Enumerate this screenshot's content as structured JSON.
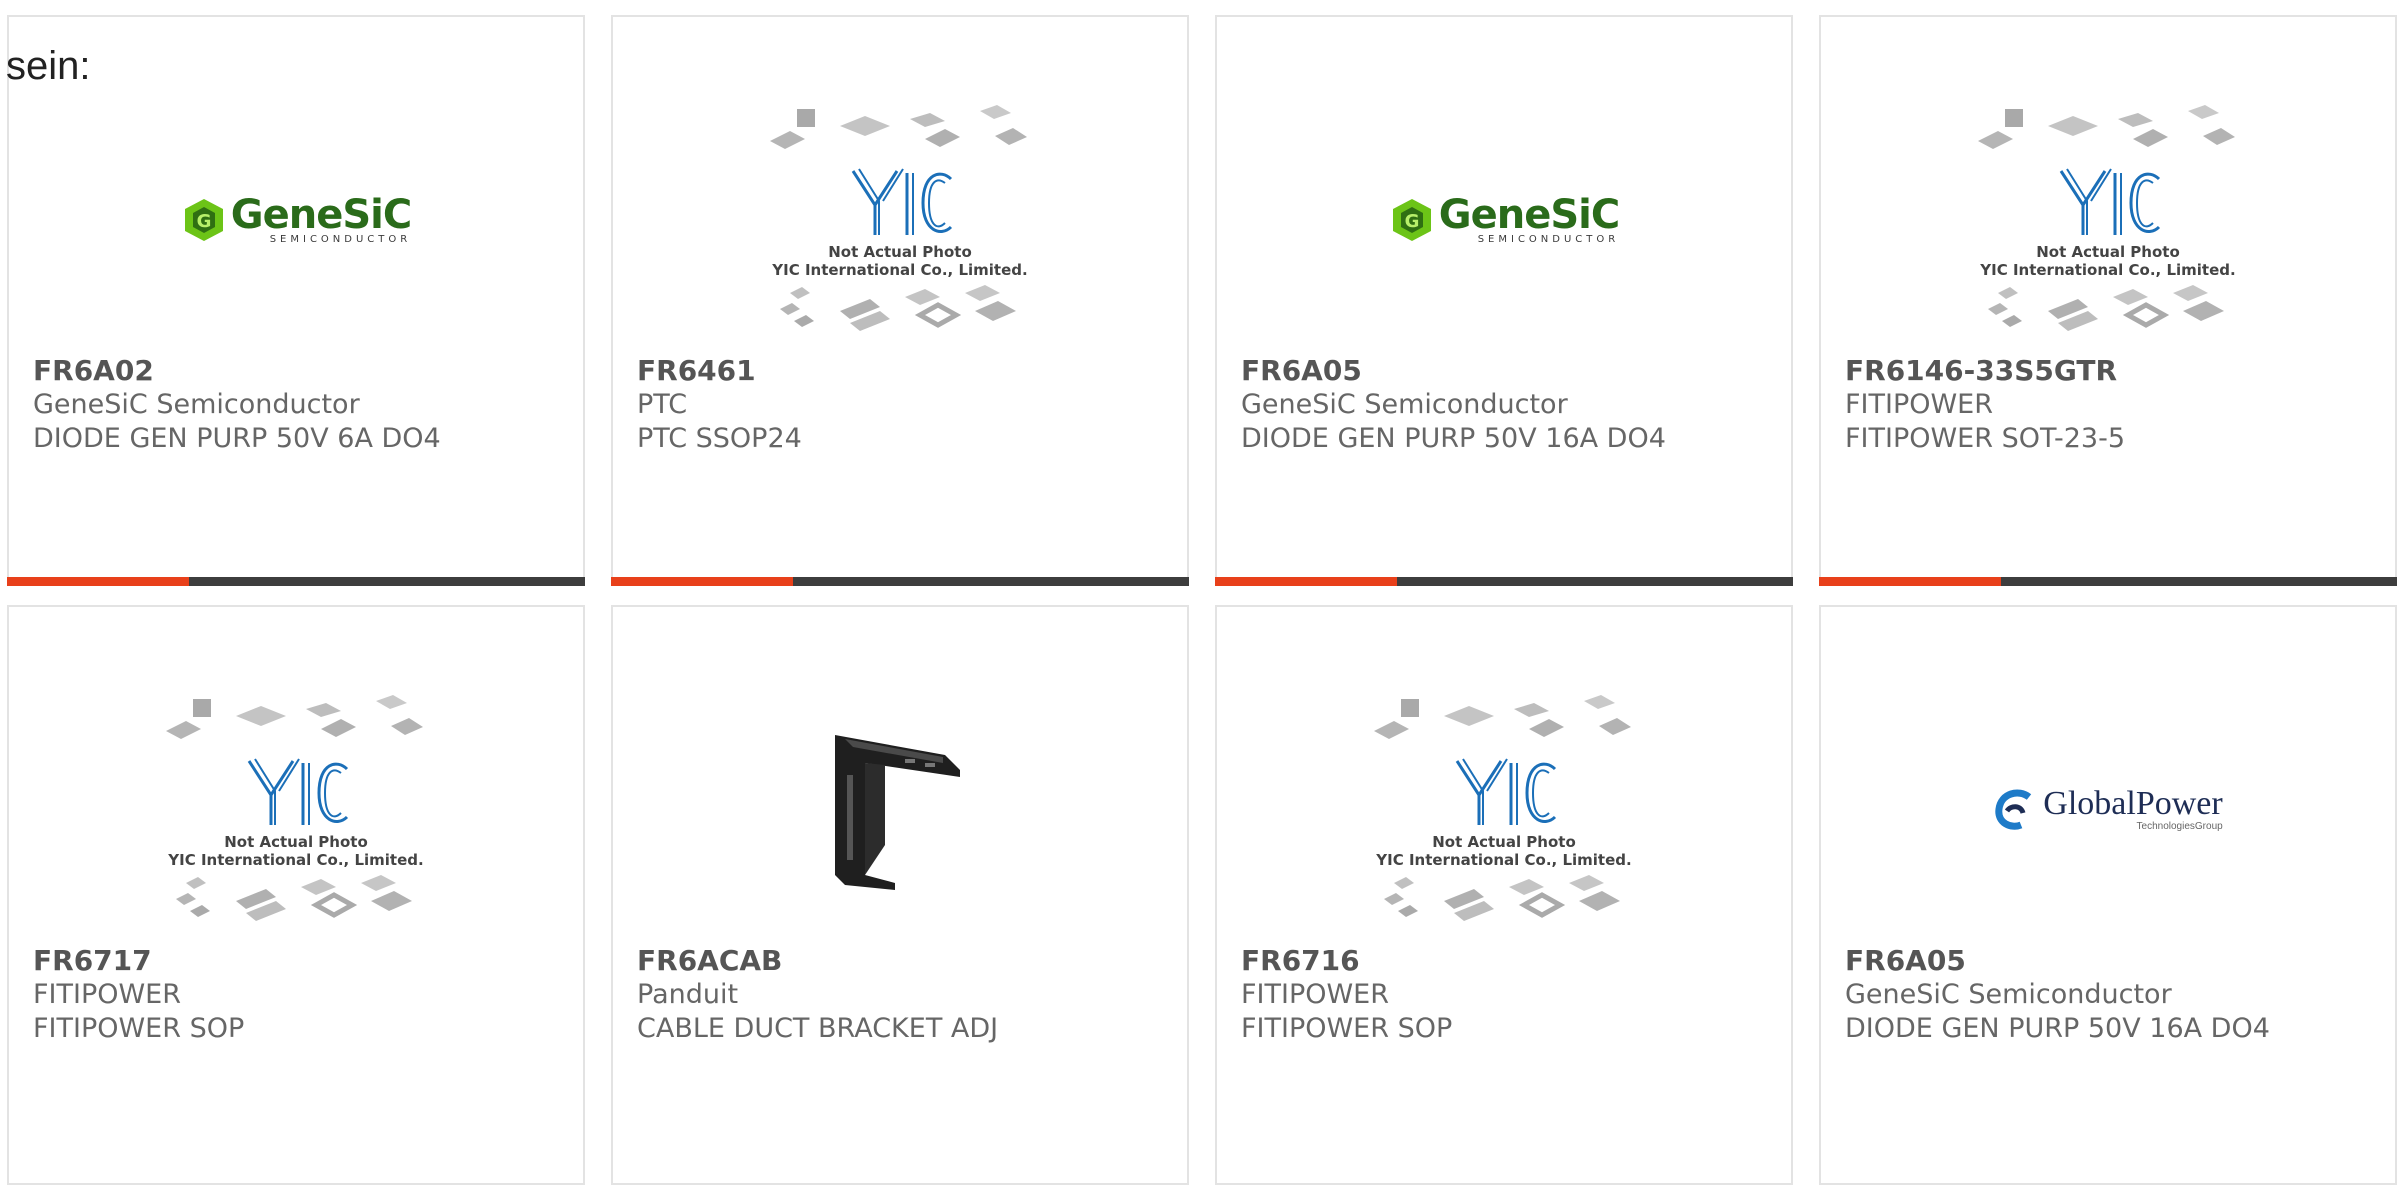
{
  "intro_text": "sein:",
  "colors": {
    "accent": "#e8401a",
    "bar": "#3d3d3d",
    "border": "#e3e3e3",
    "yic_blue": "#1b6fb8",
    "genesic_green": "#6cc417"
  },
  "products": [
    {
      "part": "FR6A02",
      "manufacturer": "GeneSiC Semiconductor",
      "description": "DIODE GEN PURP 50V 6A DO4",
      "image": "genesic-logo"
    },
    {
      "part": "FR6461",
      "manufacturer": "PTC",
      "description": "PTC SSOP24",
      "image": "yic-placeholder"
    },
    {
      "part": "FR6A05",
      "manufacturer": "GeneSiC Semiconductor",
      "description": "DIODE GEN PURP 50V 16A DO4",
      "image": "genesic-logo"
    },
    {
      "part": "FR6146-33S5GTR",
      "manufacturer": "FITIPOWER",
      "description": "FITIPOWER SOT-23-5",
      "image": "yic-placeholder"
    },
    {
      "part": "FR6717",
      "manufacturer": "FITIPOWER",
      "description": "FITIPOWER SOP",
      "image": "yic-placeholder"
    },
    {
      "part": "FR6ACAB",
      "manufacturer": "Panduit",
      "description": "CABLE DUCT BRACKET ADJ",
      "image": "bracket-photo"
    },
    {
      "part": "FR6716",
      "manufacturer": "FITIPOWER",
      "description": "FITIPOWER SOP",
      "image": "yic-placeholder"
    },
    {
      "part": "FR6A05",
      "manufacturer": "GeneSiC Semiconductor",
      "description": "DIODE GEN PURP 50V 16A DO4",
      "image": "globalpower-logo"
    }
  ],
  "logos": {
    "genesic": {
      "word": "GeneSiC",
      "sub": "SEMICONDUCTOR"
    },
    "yic": {
      "line1": "Not Actual Photo",
      "line2": "YIC International Co., Limited."
    },
    "globalpower": {
      "word": "GlobalPower",
      "sub": "TechnologiesGroup"
    }
  }
}
